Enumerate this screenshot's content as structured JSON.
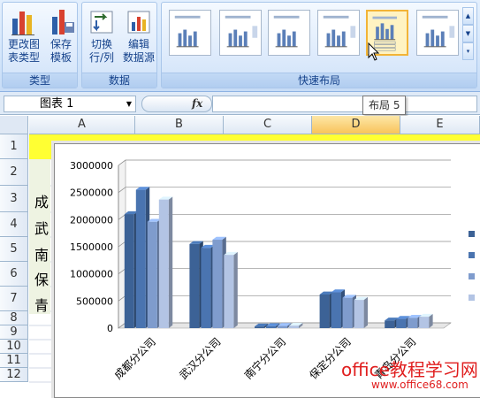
{
  "ribbon": {
    "buttons": [
      {
        "label": "更改图\n表类型",
        "line1": "更改图",
        "line2": "表类型",
        "icon": "change-chart-type-icon"
      },
      {
        "label": "保存\n模板",
        "line1": "保存",
        "line2": "模板",
        "icon": "save-template-icon"
      },
      {
        "label": "切换\n行/列",
        "line1": "切换",
        "line2": "行/列",
        "icon": "switch-row-column-icon"
      },
      {
        "label": "编辑\n数据源",
        "line1": "编辑",
        "line2": "数据源",
        "icon": "select-data-icon"
      }
    ],
    "groups": {
      "type": "类型",
      "data": "数据",
      "layout": "快速布局"
    },
    "layouts_count": 6,
    "selected_layout_index": 4
  },
  "tooltip": "布局 5",
  "formula_bar": {
    "name_box": "图表 1",
    "fx": "fx",
    "formula": ""
  },
  "grid": {
    "columns": [
      "A",
      "B",
      "C",
      "D",
      "E"
    ],
    "active_column": "D",
    "rows": [
      "1",
      "2",
      "3",
      "4",
      "5",
      "6",
      "7",
      "8",
      "9",
      "10",
      "11",
      "12"
    ],
    "column_a_visible_chars": [
      "成",
      "武",
      "南",
      "保",
      "青"
    ]
  },
  "chart_data": {
    "type": "bar",
    "categories": [
      "成都分公司",
      "武汉分公司",
      "南宁分公司",
      "保定分公司",
      "青岛分公司"
    ],
    "series": [
      {
        "values": [
          2100000,
          1550000,
          30000,
          620000,
          140000
        ],
        "color": "#3c6296"
      },
      {
        "values": [
          2550000,
          1480000,
          35000,
          660000,
          170000
        ],
        "color": "#4a74b0"
      },
      {
        "values": [
          1960000,
          1630000,
          40000,
          560000,
          190000
        ],
        "color": "#7f9ccd"
      },
      {
        "values": [
          2370000,
          1350000,
          45000,
          520000,
          210000
        ],
        "color": "#b3c4e4"
      }
    ],
    "ylim": [
      0,
      3000000
    ],
    "yticks": [
      "0",
      "500000",
      "1000000",
      "1500000",
      "2000000",
      "2500000",
      "3000000"
    ],
    "grid": true,
    "legend_position": "right",
    "title": "",
    "xlabel": "",
    "ylabel": ""
  },
  "watermark": {
    "line1": "office教程学习网",
    "line2": "www.office68.com"
  },
  "colors": {
    "accent": "#f2b437",
    "ribbon_text": "#15428b",
    "highlight_row": "#ffff33"
  }
}
